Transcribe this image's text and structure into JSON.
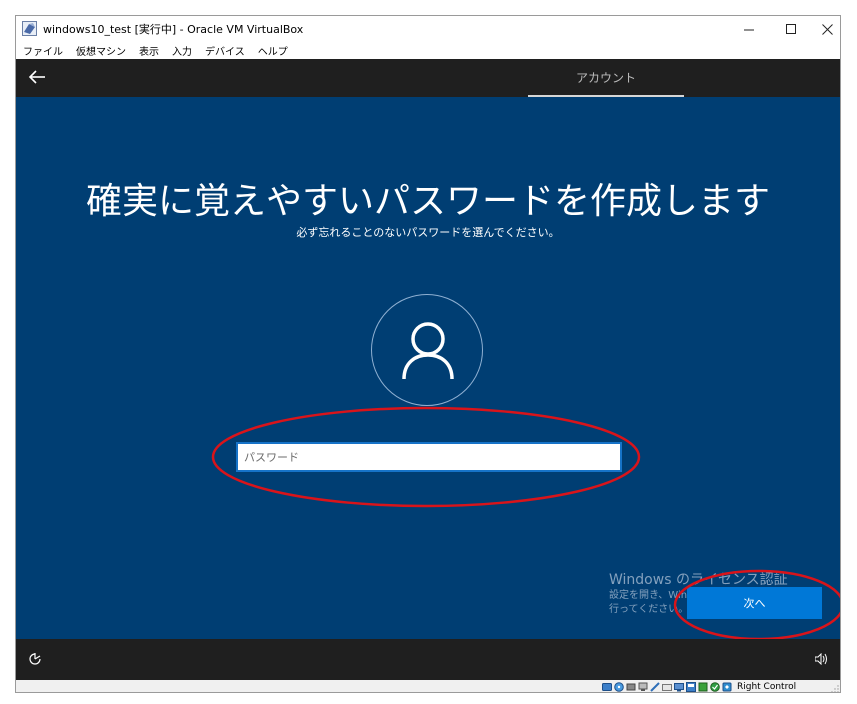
{
  "window": {
    "title": "windows10_test [実行中] - Oracle VM VirtualBox",
    "minimize_glyph": "—",
    "maximize_glyph": "☐",
    "close_glyph": "✕"
  },
  "menu": {
    "items": [
      {
        "label": "ファイル"
      },
      {
        "label": "仮想マシン"
      },
      {
        "label": "表示"
      },
      {
        "label": "入力"
      },
      {
        "label": "デバイス"
      },
      {
        "label": "ヘルプ"
      }
    ]
  },
  "guest": {
    "tab_label": "アカウント",
    "heading": "確実に覚えやすいパスワードを作成します",
    "subheading": "必ず忘れることのないパスワードを選んでください。",
    "password": {
      "value": "",
      "placeholder": "パスワード"
    },
    "watermark": {
      "title": "Windows のライセンス認証",
      "line1": "設定を開き、Windows のライセンス認証を",
      "line2": "行ってください。"
    },
    "next_label": "次へ"
  },
  "statusbar": {
    "host_key": "Right Control"
  },
  "colors": {
    "guest_background": "#003e73",
    "dark_bar": "#1f1f1f",
    "accent": "#0078d7",
    "annotation": "#d9141a"
  },
  "icons": {
    "back": "arrow-left-icon",
    "avatar": "user-icon",
    "ease_of_access": "ease-of-access-icon",
    "volume": "volume-icon"
  }
}
